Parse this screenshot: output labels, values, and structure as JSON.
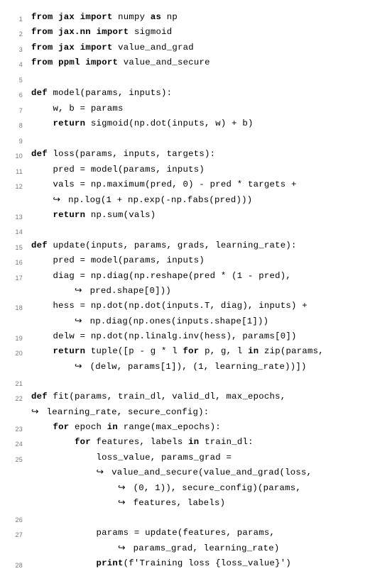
{
  "lines": [
    {
      "num": "1",
      "indent": 0,
      "wrap_from": null,
      "segs": [
        [
          "kw",
          "from"
        ],
        [
          "",
          " "
        ],
        [
          "kw",
          "jax"
        ],
        [
          "",
          " "
        ],
        [
          "kw",
          "import"
        ],
        [
          "",
          " numpy "
        ],
        [
          "kw",
          "as"
        ],
        [
          "",
          " np"
        ]
      ]
    },
    {
      "num": "2",
      "indent": 0,
      "wrap_from": null,
      "segs": [
        [
          "kw",
          "from"
        ],
        [
          "",
          " "
        ],
        [
          "kw",
          "jax.nn"
        ],
        [
          "",
          " "
        ],
        [
          "kw",
          "import"
        ],
        [
          "",
          " sigmoid"
        ]
      ]
    },
    {
      "num": "3",
      "indent": 0,
      "wrap_from": null,
      "segs": [
        [
          "kw",
          "from"
        ],
        [
          "",
          " "
        ],
        [
          "kw",
          "jax"
        ],
        [
          "",
          " "
        ],
        [
          "kw",
          "import"
        ],
        [
          "",
          " value_and_grad"
        ]
      ]
    },
    {
      "num": "4",
      "indent": 0,
      "wrap_from": null,
      "segs": [
        [
          "kw",
          "from"
        ],
        [
          "",
          " "
        ],
        [
          "kw",
          "ppml"
        ],
        [
          "",
          " "
        ],
        [
          "kw",
          "import"
        ],
        [
          "",
          " value_and_secure"
        ]
      ]
    },
    {
      "num": "5",
      "indent": 0,
      "wrap_from": null,
      "segs": []
    },
    {
      "num": "6",
      "indent": 0,
      "wrap_from": null,
      "segs": [
        [
          "kw",
          "def"
        ],
        [
          "",
          " model(params, inputs):"
        ]
      ]
    },
    {
      "num": "7",
      "indent": 1,
      "wrap_from": null,
      "segs": [
        [
          "",
          "w, b = params"
        ]
      ]
    },
    {
      "num": "8",
      "indent": 1,
      "wrap_from": null,
      "segs": [
        [
          "kw",
          "return"
        ],
        [
          "",
          " sigmoid(np.dot(inputs, w) + b)"
        ]
      ]
    },
    {
      "num": "9",
      "indent": 0,
      "wrap_from": null,
      "segs": []
    },
    {
      "num": "10",
      "indent": 0,
      "wrap_from": null,
      "segs": [
        [
          "kw",
          "def"
        ],
        [
          "",
          " loss(params, inputs, targets):"
        ]
      ]
    },
    {
      "num": "11",
      "indent": 1,
      "wrap_from": null,
      "segs": [
        [
          "",
          "pred = model(params, inputs)"
        ]
      ]
    },
    {
      "num": "12",
      "indent": 1,
      "wrap_from": null,
      "segs": [
        [
          "",
          "vals = np.maximum(pred, 0) - pred * targets +"
        ]
      ]
    },
    {
      "num": "",
      "indent": 1,
      "wrap_from": 1,
      "segs": [
        [
          "",
          " np.log(1 + np.exp(-np.fabs(pred)))"
        ]
      ]
    },
    {
      "num": "13",
      "indent": 1,
      "wrap_from": null,
      "segs": [
        [
          "kw",
          "return"
        ],
        [
          "",
          " np.sum(vals)"
        ]
      ]
    },
    {
      "num": "14",
      "indent": 0,
      "wrap_from": null,
      "segs": []
    },
    {
      "num": "15",
      "indent": 0,
      "wrap_from": null,
      "segs": [
        [
          "kw",
          "def"
        ],
        [
          "",
          " update(inputs, params, grads, learning_rate):"
        ]
      ]
    },
    {
      "num": "16",
      "indent": 1,
      "wrap_from": null,
      "segs": [
        [
          "",
          "pred = model(params, inputs)"
        ]
      ]
    },
    {
      "num": "17",
      "indent": 1,
      "wrap_from": null,
      "segs": [
        [
          "",
          "diag = np.diag(np.reshape(pred * (1 - pred),"
        ]
      ]
    },
    {
      "num": "",
      "indent": 2,
      "wrap_from": 2,
      "segs": [
        [
          "",
          " pred.shape[0]))"
        ]
      ]
    },
    {
      "num": "18",
      "indent": 1,
      "wrap_from": null,
      "segs": [
        [
          "",
          "hess = np.dot(np.dot(inputs.T, diag), inputs) +"
        ]
      ]
    },
    {
      "num": "",
      "indent": 2,
      "wrap_from": 2,
      "segs": [
        [
          "",
          " np.diag(np.ones(inputs.shape[1]))"
        ]
      ]
    },
    {
      "num": "19",
      "indent": 1,
      "wrap_from": null,
      "segs": [
        [
          "",
          "delw = np.dot(np.linalg.inv(hess), params[0])"
        ]
      ]
    },
    {
      "num": "20",
      "indent": 1,
      "wrap_from": null,
      "segs": [
        [
          "kw",
          "return"
        ],
        [
          "",
          " tuple([p - g * l "
        ],
        [
          "kw",
          "for"
        ],
        [
          "",
          " p, g, l "
        ],
        [
          "kw",
          "in"
        ],
        [
          "",
          " zip(params,"
        ]
      ]
    },
    {
      "num": "",
      "indent": 2,
      "wrap_from": 2,
      "segs": [
        [
          "",
          " (delw, params[1]), (1, learning_rate))])"
        ]
      ]
    },
    {
      "num": "21",
      "indent": 0,
      "wrap_from": null,
      "segs": []
    },
    {
      "num": "22",
      "indent": 0,
      "wrap_from": null,
      "segs": [
        [
          "kw",
          "def"
        ],
        [
          "",
          " fit(params, train_dl, valid_dl, max_epochs,"
        ]
      ]
    },
    {
      "num": "",
      "indent": 0,
      "wrap_from": 0,
      "segs": [
        [
          "",
          " learning_rate, secure_config):"
        ]
      ]
    },
    {
      "num": "23",
      "indent": 1,
      "wrap_from": null,
      "segs": [
        [
          "kw",
          "for"
        ],
        [
          "",
          " epoch "
        ],
        [
          "kw",
          "in"
        ],
        [
          "",
          " range(max_epochs):"
        ]
      ]
    },
    {
      "num": "24",
      "indent": 2,
      "wrap_from": null,
      "segs": [
        [
          "kw",
          "for"
        ],
        [
          "",
          " features, labels "
        ],
        [
          "kw",
          "in"
        ],
        [
          "",
          " train_dl:"
        ]
      ]
    },
    {
      "num": "25",
      "indent": 3,
      "wrap_from": null,
      "segs": [
        [
          "",
          "loss_value, params_grad ="
        ]
      ]
    },
    {
      "num": "",
      "indent": 3,
      "wrap_from": 3,
      "segs": [
        [
          "",
          " value_and_secure(value_and_grad(loss,"
        ]
      ]
    },
    {
      "num": "",
      "indent": 4,
      "wrap_from": 4,
      "segs": [
        [
          "",
          " (0, 1)), secure_config)(params,"
        ]
      ]
    },
    {
      "num": "",
      "indent": 4,
      "wrap_from": 4,
      "segs": [
        [
          "",
          " features, labels)"
        ]
      ]
    },
    {
      "num": "26",
      "indent": 0,
      "wrap_from": null,
      "segs": []
    },
    {
      "num": "27",
      "indent": 3,
      "wrap_from": null,
      "segs": [
        [
          "",
          "params = update(features, params,"
        ]
      ]
    },
    {
      "num": "",
      "indent": 4,
      "wrap_from": 4,
      "segs": [
        [
          "",
          " params_grad, learning_rate)"
        ]
      ]
    },
    {
      "num": "28",
      "indent": 3,
      "wrap_from": null,
      "segs": [
        [
          "kw",
          "print"
        ],
        [
          "",
          "(f'Training loss {loss_value}')"
        ]
      ]
    }
  ],
  "indent_unit": "    ",
  "hookarrow": "↪"
}
